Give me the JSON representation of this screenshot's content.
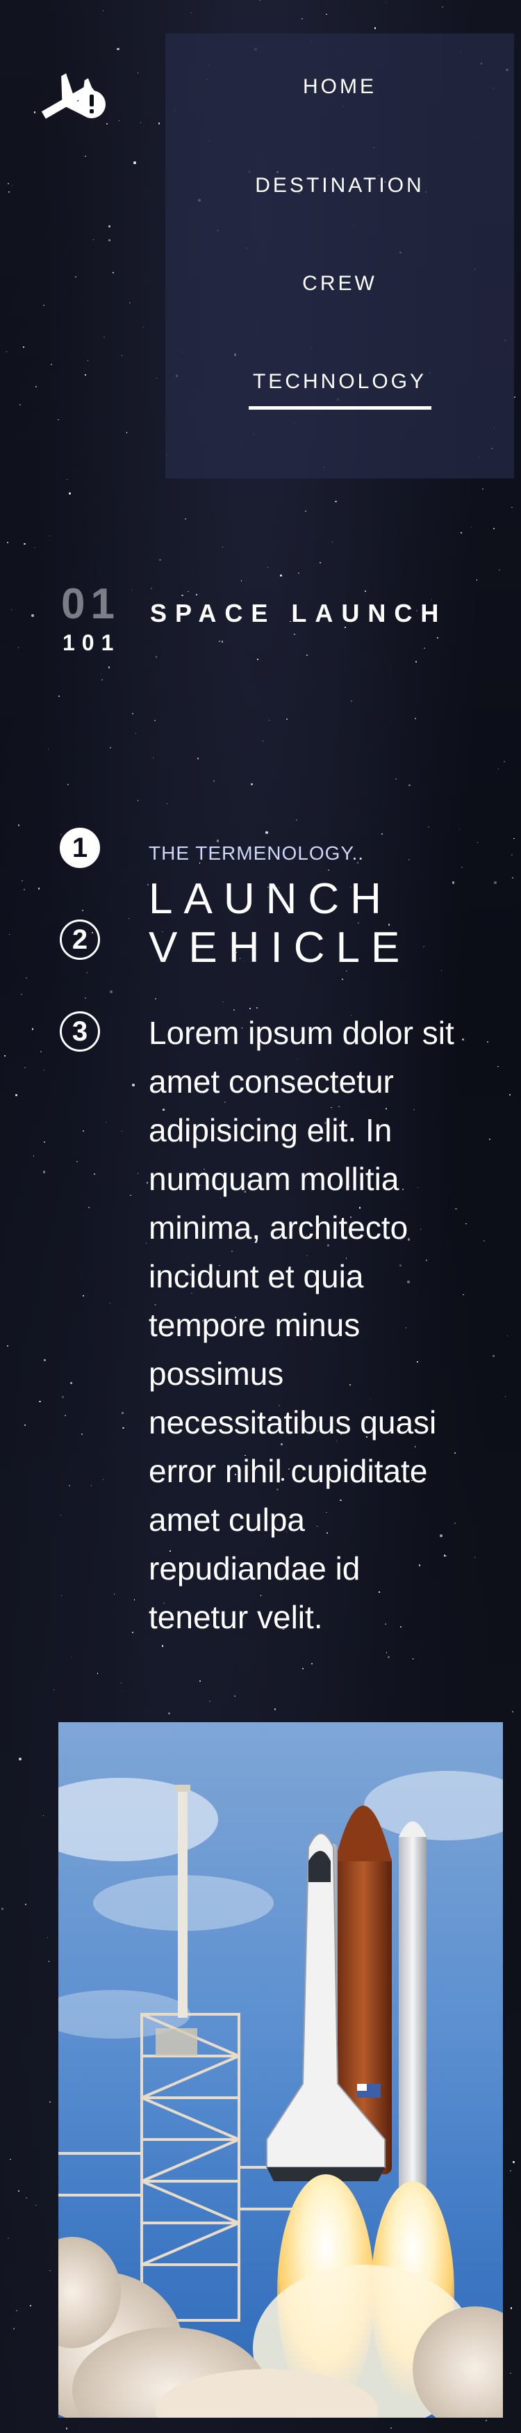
{
  "nav": {
    "items": [
      {
        "label": "HOME"
      },
      {
        "label": "DESTINATION"
      },
      {
        "label": "CREW"
      },
      {
        "label": "TECHNOLOGY"
      }
    ],
    "active": "TECHNOLOGY"
  },
  "logo": {
    "icon": "plane-alert-icon"
  },
  "section": {
    "number": "01",
    "sub_number": "101",
    "title": "SPACE LAUNCH"
  },
  "pager": [
    "1",
    "2",
    "3"
  ],
  "pager_active": "1",
  "content": {
    "eyebrow": "THE TERMENOLOGY..",
    "title_line1": "LAUNCH",
    "title_line2": "VEHICLE",
    "description": "Lorem ipsum dolor sit amet consectetur adipisicing elit. In numquam mollitia minima, architecto incidunt et quia tempore minus possimus necessitatibus quasi error nihil cupiditate amet culpa repudiandae id tenetur velit."
  },
  "image": {
    "subject": "launch-vehicle-photo"
  },
  "colors": {
    "background": "#0b0d17",
    "nav_panel": "#262a46",
    "accent": "#ffffff",
    "eyebrow": "#d0d6f9"
  }
}
